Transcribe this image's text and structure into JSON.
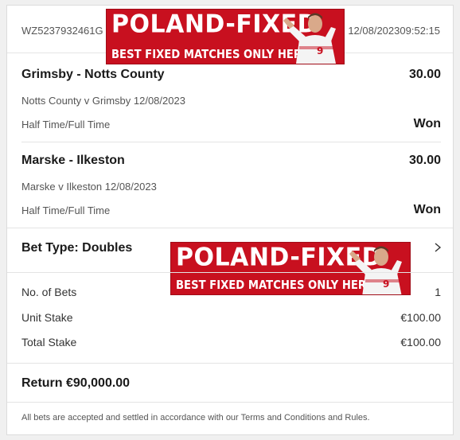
{
  "header": {
    "reference": "WZ5237932461G",
    "date": "12/08/2023",
    "time": "09:52:15"
  },
  "banner": {
    "title": "POLAND-FIXED",
    "subtitle": "BEST FIXED MATCHES ONLY HERE!",
    "color": "#c8101f"
  },
  "legs": [
    {
      "title": "Grimsby - Notts County",
      "stake": "30.00",
      "fixture": "Notts County v Grimsby 12/08/2023",
      "market": "Half Time/Full Time",
      "result": "Won"
    },
    {
      "title": "Marske - Ilkeston",
      "stake": "30.00",
      "fixture": "Marske v Ilkeston 12/08/2023",
      "market": "Half Time/Full Time",
      "result": "Won"
    }
  ],
  "bet_type": "Bet Type: Doubles",
  "summary": [
    {
      "label": "No. of Bets",
      "value": "1"
    },
    {
      "label": "Unit Stake",
      "value": "€100.00"
    },
    {
      "label": "Total Stake",
      "value": "€100.00"
    }
  ],
  "return_text": "Return €90,000.00",
  "footer": "All bets are accepted and settled in accordance with our Terms and Conditions and Rules.",
  "icons": {
    "chevron": "chevron-right-icon"
  }
}
